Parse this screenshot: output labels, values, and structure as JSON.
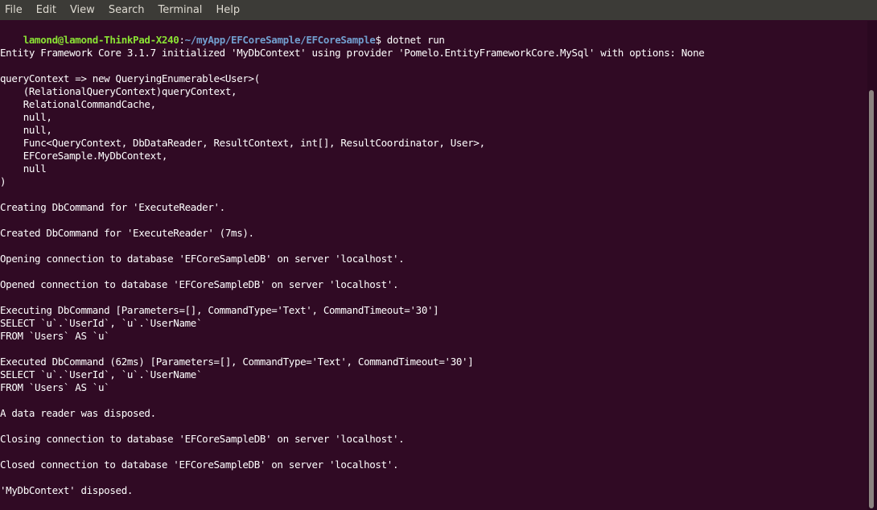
{
  "menu": [
    "File",
    "Edit",
    "View",
    "Search",
    "Terminal",
    "Help"
  ],
  "prompt": {
    "user_host": "lamond@lamond-ThinkPad-X240",
    "sep": ":",
    "path": "~/myApp/EFCoreSample/EFCoreSample",
    "symbol": "$"
  },
  "command": " dotnet run",
  "output": [
    "Entity Framework Core 3.1.7 initialized 'MyDbContext' using provider 'Pomelo.EntityFrameworkCore.MySql' with options: None",
    "",
    "queryContext => new QueryingEnumerable<User>(",
    "    (RelationalQueryContext)queryContext,",
    "    RelationalCommandCache,",
    "    null,",
    "    null,",
    "    Func<QueryContext, DbDataReader, ResultContext, int[], ResultCoordinator, User>,",
    "    EFCoreSample.MyDbContext,",
    "    null",
    ")",
    "",
    "Creating DbCommand for 'ExecuteReader'.",
    "",
    "Created DbCommand for 'ExecuteReader' (7ms).",
    "",
    "Opening connection to database 'EFCoreSampleDB' on server 'localhost'.",
    "",
    "Opened connection to database 'EFCoreSampleDB' on server 'localhost'.",
    "",
    "Executing DbCommand [Parameters=[], CommandType='Text', CommandTimeout='30']",
    "SELECT `u`.`UserId`, `u`.`UserName`",
    "FROM `Users` AS `u`",
    "",
    "Executed DbCommand (62ms) [Parameters=[], CommandType='Text', CommandTimeout='30']",
    "SELECT `u`.`UserId`, `u`.`UserName`",
    "FROM `Users` AS `u`",
    "",
    "A data reader was disposed.",
    "",
    "Closing connection to database 'EFCoreSampleDB' on server 'localhost'.",
    "",
    "Closed connection to database 'EFCoreSampleDB' on server 'localhost'.",
    "",
    "'MyDbContext' disposed."
  ],
  "colors": {
    "background": "#300a24",
    "prompt_user": "#8ae234",
    "prompt_path": "#729fcf",
    "text": "#ffffff",
    "menubar": "#3c3b37"
  }
}
